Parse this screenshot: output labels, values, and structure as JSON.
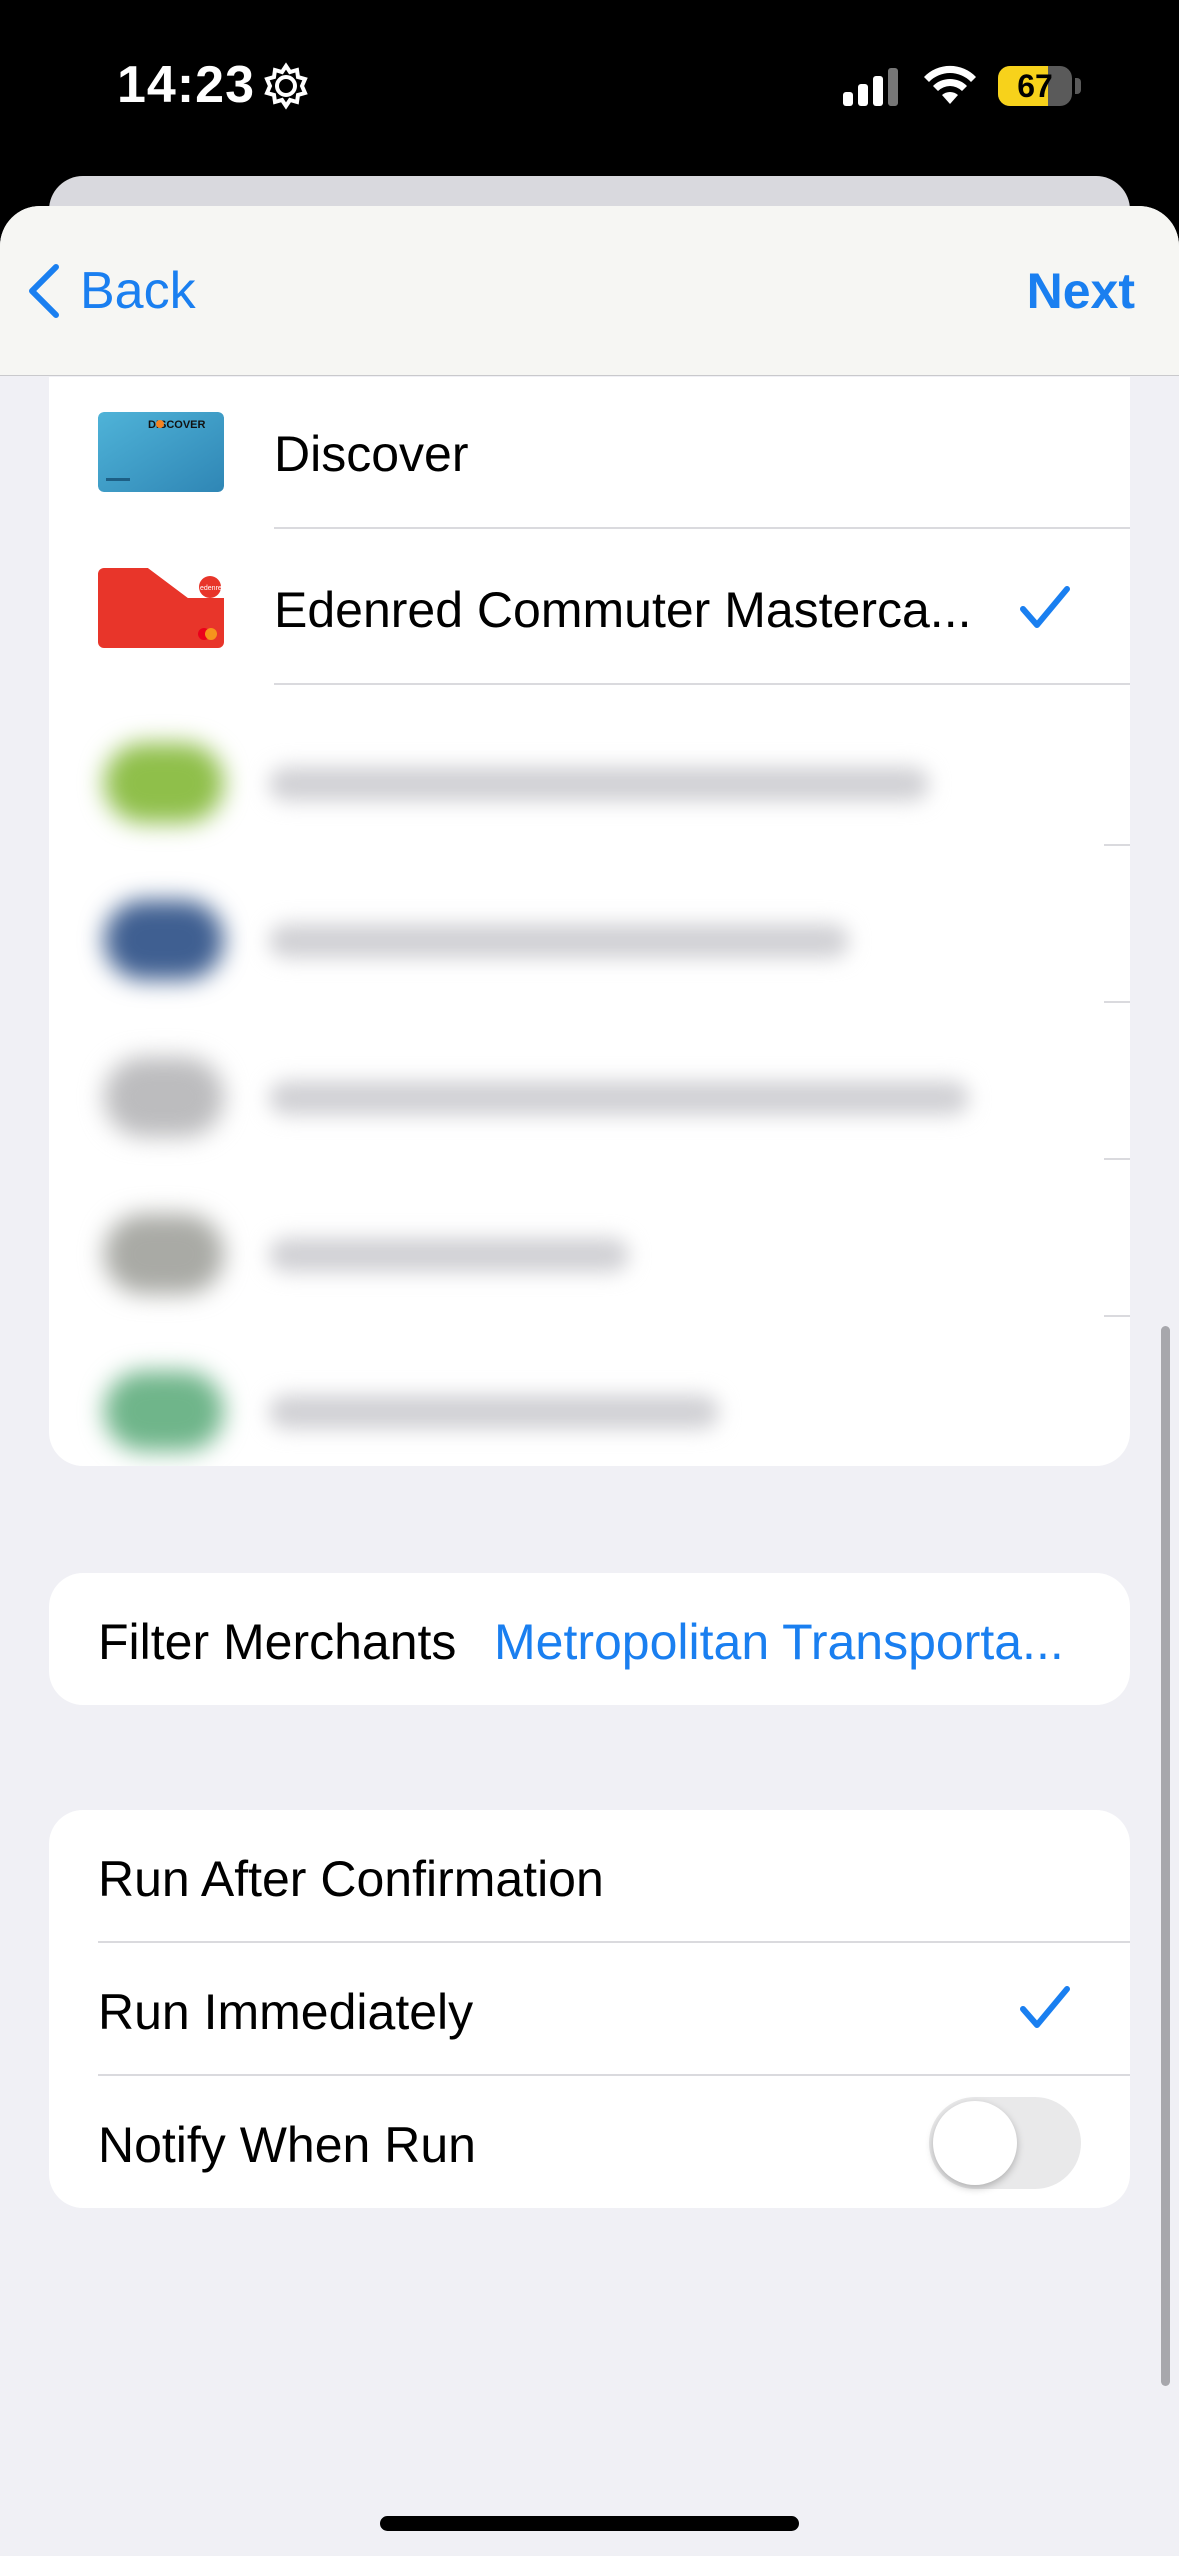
{
  "status_bar": {
    "time": "14:23",
    "battery": "67",
    "battery_level": 0.67,
    "icons": [
      "gear-icon",
      "cellular-signal-icon",
      "wifi-icon",
      "battery-icon"
    ]
  },
  "nav": {
    "back_label": "Back",
    "next_label": "Next",
    "accent": "#1a7ff0"
  },
  "cards": [
    {
      "name": "Discover",
      "selected": false
    },
    {
      "name": "Edenred Commuter Masterca...",
      "selected": true
    }
  ],
  "card_logos": {
    "discover": "DISCOVER",
    "edenred": "edenred"
  },
  "filter": {
    "label": "Filter Merchants",
    "value": "Metropolitan Transporta..."
  },
  "run_options": {
    "run_after_confirmation": "Run After Confirmation",
    "run_immediately": "Run Immediately",
    "notify_when_run": "Notify When Run",
    "selected": "run_immediately",
    "notify_enabled": false
  }
}
